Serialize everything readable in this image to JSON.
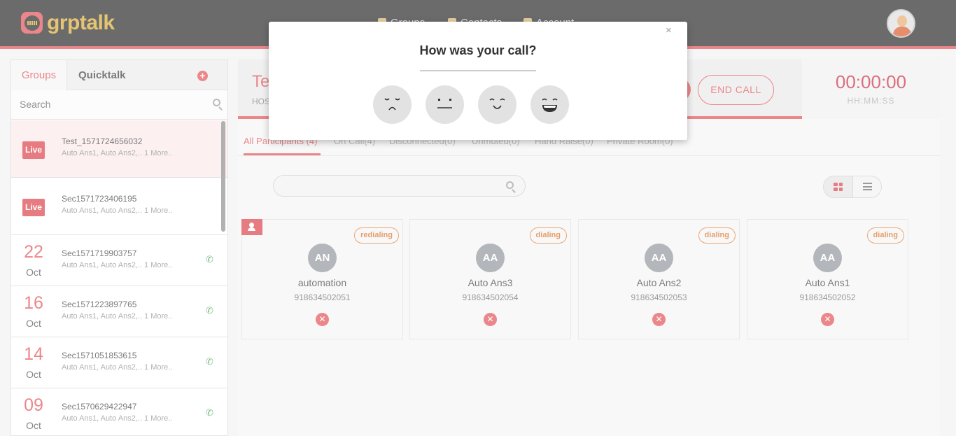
{
  "app": {
    "logo_text": "grptalk"
  },
  "nav": {
    "items": [
      {
        "label": "Groups",
        "icon": "group-icon"
      },
      {
        "label": "Contacts",
        "icon": "contacts-icon"
      },
      {
        "label": "Account",
        "icon": "account-icon"
      }
    ]
  },
  "sidebar": {
    "tabs": {
      "groups": "Groups",
      "quicktalk": "Quicktalk"
    },
    "add_label": "+",
    "search_placeholder": "Search",
    "items": [
      {
        "badge": "Live",
        "title": "Test_1571724656032",
        "subtitle": "Auto Ans1, Auto Ans2,.. 1 More.."
      },
      {
        "badge": "Live",
        "title": "Sec1571723406195",
        "subtitle": "Auto Ans1, Auto Ans2,.. 1 More.."
      },
      {
        "day": "22",
        "month": "Oct",
        "title": "Sec1571719903757",
        "subtitle": "Auto Ans1, Auto Ans2,.. 1 More.."
      },
      {
        "day": "16",
        "month": "Oct",
        "title": "Sec1571223897765",
        "subtitle": "Auto Ans1, Auto Ans2,.. 1 More.."
      },
      {
        "day": "14",
        "month": "Oct",
        "title": "Sec1571051853615",
        "subtitle": "Auto Ans1, Auto Ans2,.. 1 More.."
      },
      {
        "day": "09",
        "month": "Oct",
        "title": "Sec1570629422947",
        "subtitle": "Auto Ans1, Auto Ans2,.. 1 More.."
      }
    ]
  },
  "call": {
    "title": "Te",
    "host_label": "HOS",
    "end_call": "END CALL",
    "timer": "00:00:00",
    "timer_format": "HH:MM:SS"
  },
  "filters": [
    "All Participants (4)",
    "On Call(4)",
    "Disconnected(0)",
    "Unmuted(0)",
    "Hand Raise(0)",
    "Private Room(0)"
  ],
  "participants": [
    {
      "initials": "AN",
      "name": "automation",
      "number": "918634502051",
      "status": "redialing",
      "host": true
    },
    {
      "initials": "AA",
      "name": "Auto Ans3",
      "number": "918634502054",
      "status": "dialing",
      "host": false
    },
    {
      "initials": "AA",
      "name": "Auto Ans2",
      "number": "918634502053",
      "status": "dialing",
      "host": false
    },
    {
      "initials": "AA",
      "name": "Auto Ans1",
      "number": "918634502052",
      "status": "dialing",
      "host": false
    }
  ],
  "modal": {
    "title": "How was your call?",
    "close": "×",
    "ratings": [
      "sad-face-icon",
      "neutral-face-icon",
      "smile-face-icon",
      "happy-face-icon"
    ]
  },
  "colors": {
    "accent": "#e0474c",
    "brand_gold": "#d6a72a",
    "status_orange": "#d86a1d",
    "nav_bg": "#1c1c1c"
  }
}
